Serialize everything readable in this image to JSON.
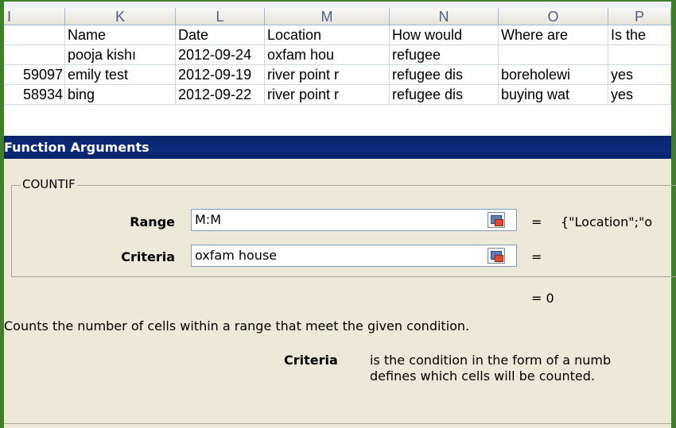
{
  "spreadsheet": {
    "columns": [
      "I",
      "K",
      "L",
      "M",
      "N",
      "O",
      "P"
    ],
    "rows": [
      {
        "i": "",
        "k": "Name",
        "l": "Date",
        "m": "Location",
        "n": "How would",
        "o": "Where are",
        "p": "Is the"
      },
      {
        "i": "",
        "k": "pooja kishı",
        "l": "2012-09-24",
        "m": "oxfam hou",
        "n": "refugee",
        "o": "",
        "p": ""
      },
      {
        "i": "59097",
        "k": "emily test",
        "l": "2012-09-19",
        "m": "river point r",
        "n": "refugee dis",
        "o": "boreholewi",
        "p": "yes"
      },
      {
        "i": "58934",
        "k": "bing",
        "l": "2012-09-22",
        "m": "river point r",
        "n": "refugee dis",
        "o": "buying wat",
        "p": "yes"
      }
    ]
  },
  "dialog": {
    "title": "Function Arguments",
    "function_name": "COUNTIF",
    "args": [
      {
        "label": "Range",
        "value": "M:M",
        "result": "{\"Location\";\"o"
      },
      {
        "label": "Criteria",
        "value": "oxfam house",
        "result": ""
      }
    ],
    "equals": "=",
    "formula_result": "=  0",
    "description": "Counts the number of cells within a range that meet the given condition.",
    "help_arg": "Criteria",
    "help_line1": "is the condition in the form of a numb",
    "help_line2": "defines which cells will be counted."
  }
}
